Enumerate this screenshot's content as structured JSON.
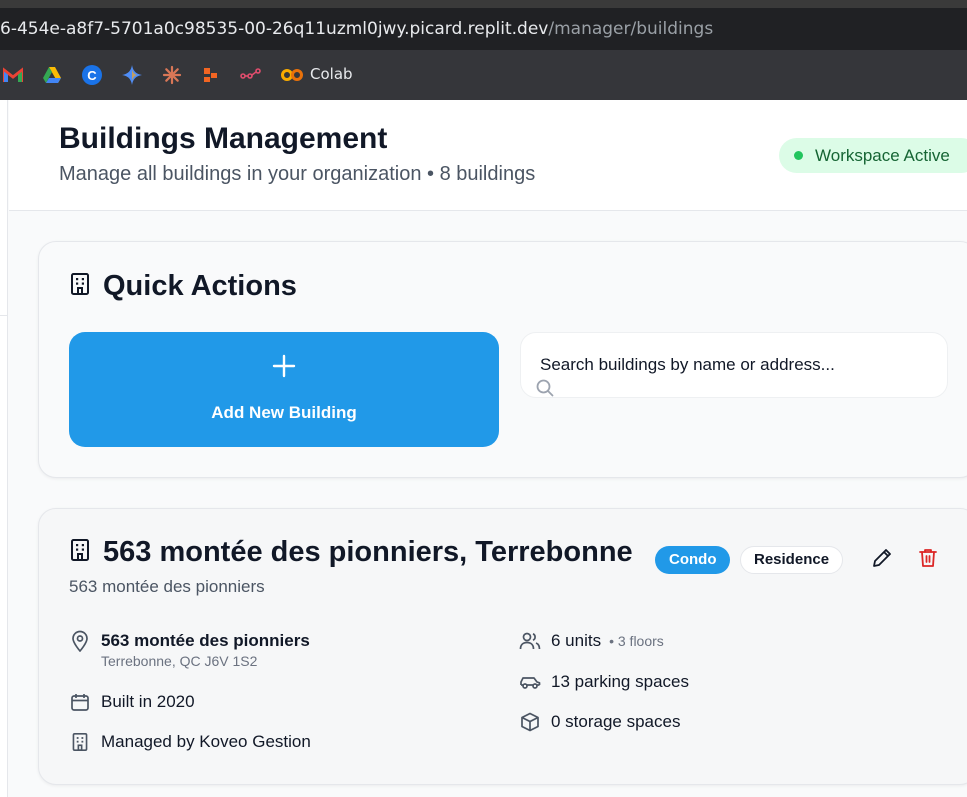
{
  "browser": {
    "url_host": "6-454e-a8f7-5701a0c98535-00-26q11uzml0jwy.picard.replit.dev",
    "url_path": "/manager/buildings",
    "bookmarks": [
      {
        "icon": "gmail-icon"
      },
      {
        "icon": "google-drive-icon"
      },
      {
        "icon": "c-icon"
      },
      {
        "icon": "gemini-icon"
      },
      {
        "icon": "claude-icon"
      },
      {
        "icon": "orange-blocks-icon"
      },
      {
        "icon": "share-nodes-icon"
      },
      {
        "icon": "colab-icon",
        "label": "Colab"
      }
    ]
  },
  "header": {
    "title": "Buildings Management",
    "subtitle": "Manage all buildings in your organization • 8 buildings",
    "workspace_status": "Workspace Active"
  },
  "quick_actions": {
    "title": "Quick Actions",
    "add_button_label": "Add New Building",
    "search_placeholder": "Search buildings by name or address..."
  },
  "building": {
    "title": "563 montée des pionniers, Terrebonne",
    "type_badge": "Condo",
    "residence_badge": "Residence",
    "subtitle": "563 montée des pionniers",
    "address_line1": "563 montée des pionniers",
    "address_line2": "Terrebonne, QC J6V 1S2",
    "built": "Built in 2020",
    "managed_by": "Managed by Koveo Gestion",
    "units": "6 units",
    "floors": "• 3 floors",
    "parking": "13 parking spaces",
    "storage": "0 storage spaces"
  },
  "colors": {
    "primary": "#2199e8",
    "success_bg": "#dcfce7",
    "success_text": "#166534",
    "danger": "#dc2626"
  }
}
